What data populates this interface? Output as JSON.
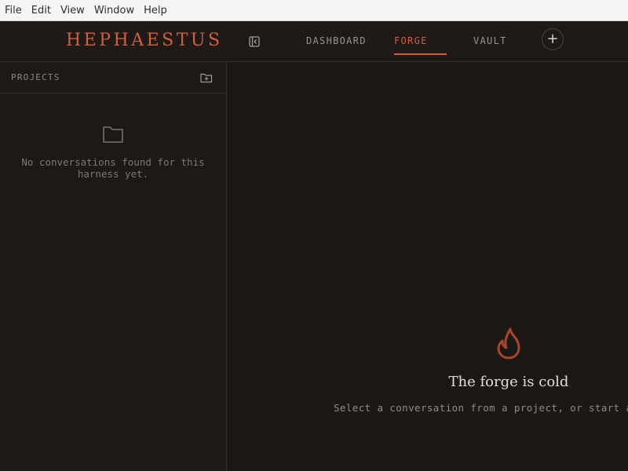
{
  "menubar": {
    "items": [
      "File",
      "Edit",
      "View",
      "Window",
      "Help"
    ]
  },
  "header": {
    "brand": "HEPHAESTUS",
    "tabs": [
      {
        "label": "DASHBOARD"
      },
      {
        "label": "FORGE"
      },
      {
        "label": "VAULT"
      }
    ],
    "active_tab": "FORGE",
    "add_label": "+"
  },
  "sidebar": {
    "title": "PROJECTS",
    "empty_message": "No conversations found for this harness yet."
  },
  "main": {
    "empty_title": "The forge is cold",
    "empty_subtitle": "Select a conversation from a project, or start a"
  },
  "colors": {
    "accent": "#d0603a",
    "flame": "#a8452c",
    "background": "#1c1816"
  },
  "icons": {
    "collapse": "sidebar-collapse-icon",
    "new_folder": "folder-plus-icon",
    "empty": "folder-icon",
    "main_empty": "flame-icon"
  }
}
